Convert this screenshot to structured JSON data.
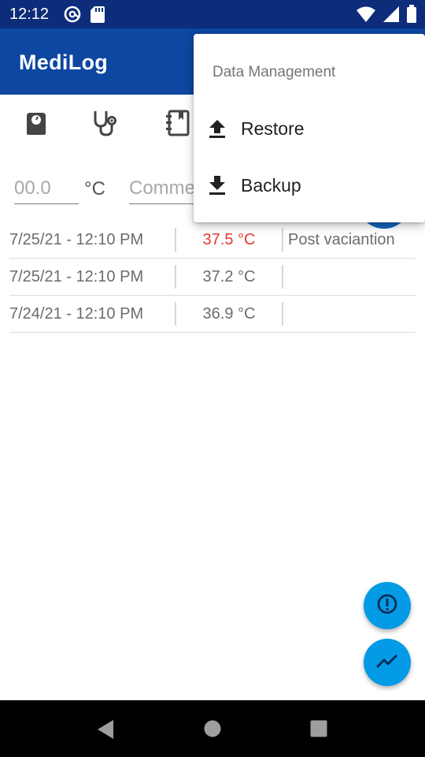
{
  "status_bar": {
    "time": "12:12",
    "icons": [
      "at-sign-icon",
      "sd-card-icon",
      "wifi-icon",
      "signal-icon",
      "battery-icon"
    ]
  },
  "app_bar": {
    "title": "MediLog",
    "color": "#0d47a1"
  },
  "toolbar": {
    "icons": [
      "weight-scale-icon",
      "stethoscope-icon",
      "notebook-icon"
    ]
  },
  "entry": {
    "temp_placeholder": "00.0",
    "unit": "°C",
    "comment_placeholder": "Comment"
  },
  "log": {
    "rows": [
      {
        "date": "7/25/21 - 12:10 PM",
        "temp": "37.5 °C",
        "comment": "Post vaciantion",
        "high": true
      },
      {
        "date": "7/25/21 - 12:10 PM",
        "temp": "37.2 °C",
        "comment": "",
        "high": false
      },
      {
        "date": "7/24/21 - 12:10 PM",
        "temp": "36.9 °C",
        "comment": "",
        "high": false
      }
    ],
    "high_color": "#e53935"
  },
  "menu": {
    "header": "Data Management",
    "items": [
      {
        "label": "Restore",
        "icon": "upload-icon"
      },
      {
        "label": "Backup",
        "icon": "download-icon"
      }
    ]
  },
  "fabs": [
    {
      "icon": "info-icon"
    },
    {
      "icon": "trending-icon"
    }
  ],
  "nav_bar": {
    "buttons": [
      "back-icon",
      "home-icon",
      "recents-icon"
    ]
  }
}
